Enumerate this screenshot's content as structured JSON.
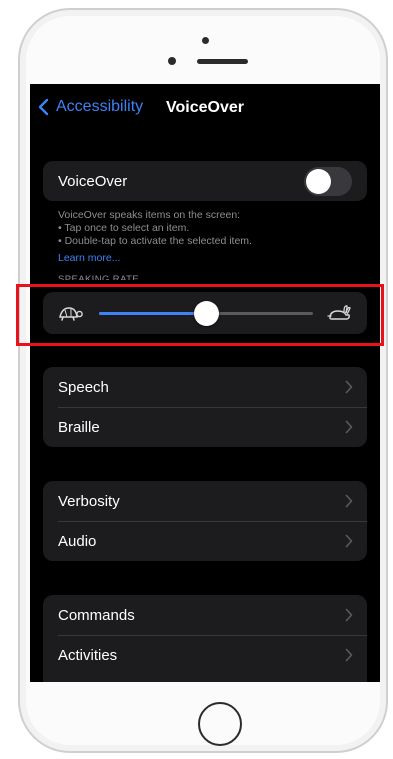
{
  "nav": {
    "back_label": "Accessibility",
    "title": "VoiceOver"
  },
  "voiceover": {
    "label": "VoiceOver",
    "enabled": false
  },
  "description": {
    "intro": "VoiceOver speaks items on the screen:",
    "bullets": [
      "Tap once to select an item.",
      "Double-tap to activate the selected item."
    ],
    "learn_more": "Learn more..."
  },
  "speaking_rate": {
    "header": "SPEAKING RATE",
    "value": 0.5,
    "slow_icon": "turtle-icon",
    "fast_icon": "hare-icon"
  },
  "groups": [
    {
      "items": [
        {
          "label": "Speech"
        },
        {
          "label": "Braille"
        }
      ]
    },
    {
      "items": [
        {
          "label": "Verbosity"
        },
        {
          "label": "Audio"
        }
      ]
    },
    {
      "items": [
        {
          "label": "Commands"
        },
        {
          "label": "Activities"
        }
      ]
    }
  ],
  "colors": {
    "accent": "#3d82f6",
    "highlight": "#e8121c",
    "background": "#000000",
    "cell": "#1c1c1e"
  }
}
